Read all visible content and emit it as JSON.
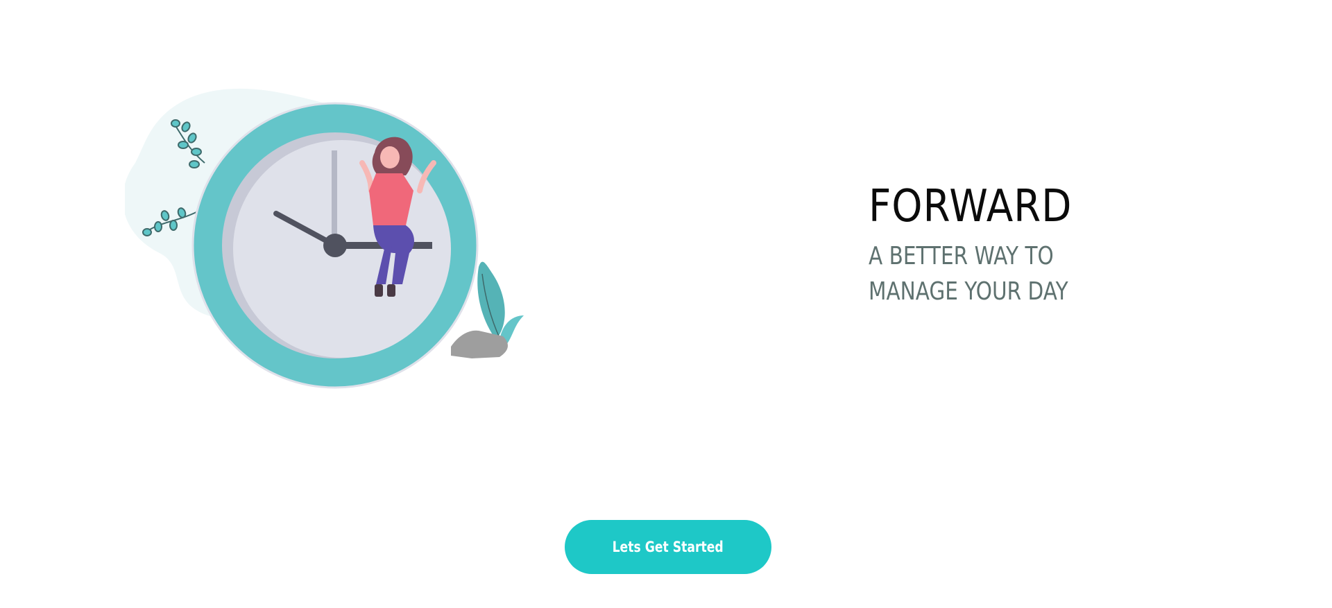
{
  "hero": {
    "title": "FORWARD",
    "tagline_line1": "A BETTER WAY TO",
    "tagline_line2": "MANAGE YOUR DAY"
  },
  "cta": {
    "label": "Lets Get Started"
  },
  "illustration": {
    "icon": "woman-sitting-on-clock-illustration"
  },
  "colors": {
    "accent": "#1ec8c7",
    "clock_ring": "#64c5c9",
    "clock_face": "#dfe1ea",
    "tagline": "#5e716f",
    "title": "#0b0b0b"
  }
}
